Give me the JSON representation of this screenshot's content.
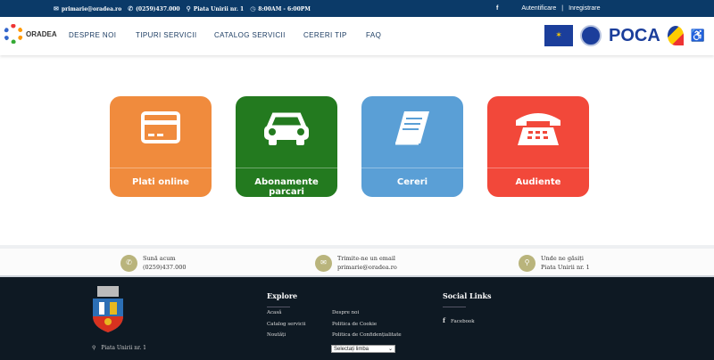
{
  "topbar": {
    "email": "primarie@oradea.ro",
    "phone": "(0259)437.000",
    "address": "Piata Unirii nr. 1",
    "hours": "8:00AM - 6:00PM",
    "login": "Autentificare",
    "separator": "|",
    "register": "Inregistrare",
    "icons": [
      "envelope-icon",
      "phone-icon",
      "map-pin-icon",
      "clock-icon",
      "facebook-icon"
    ]
  },
  "brand": {
    "name": "ORADEA"
  },
  "nav": {
    "items": [
      "DESPRE NOI",
      "TIPURI SERVICII",
      "CATALOG SERVICII",
      "CERERI TIP",
      "FAQ"
    ]
  },
  "partners": {
    "poca": "POCA"
  },
  "tiles": [
    {
      "label": "Plati online",
      "color": "#f08b3d",
      "icon": "credit-card-icon"
    },
    {
      "label": "Abonamente parcari",
      "color": "#237a1f",
      "icon": "car-icon"
    },
    {
      "label": "Cereri",
      "color": "#5a9fd6",
      "icon": "book-icon"
    },
    {
      "label": "Audiente",
      "color": "#f2483a",
      "icon": "telephone-icon"
    }
  ],
  "contact": [
    {
      "title": "Sună acum",
      "value": "(0259)437.000",
      "icon": "phone-icon"
    },
    {
      "title": "Trimite-ne un email",
      "value": "primarie@oradea.ro",
      "icon": "envelope-icon"
    },
    {
      "title": "Unde ne găsiți",
      "value": "Piata Unirii nr. 1",
      "icon": "map-pin-icon"
    }
  ],
  "footer": {
    "address": "Piata Unirii nr. 1",
    "explore_title": "Explore",
    "explore_links": [
      "Acasă",
      "Catalog servicii",
      "Noutăți",
      "Despre noi",
      "Politica de Cookie",
      "Politica de Confidențialitate"
    ],
    "language_select": "Selectați limba",
    "social_title": "Social Links",
    "facebook": "Facebook"
  }
}
